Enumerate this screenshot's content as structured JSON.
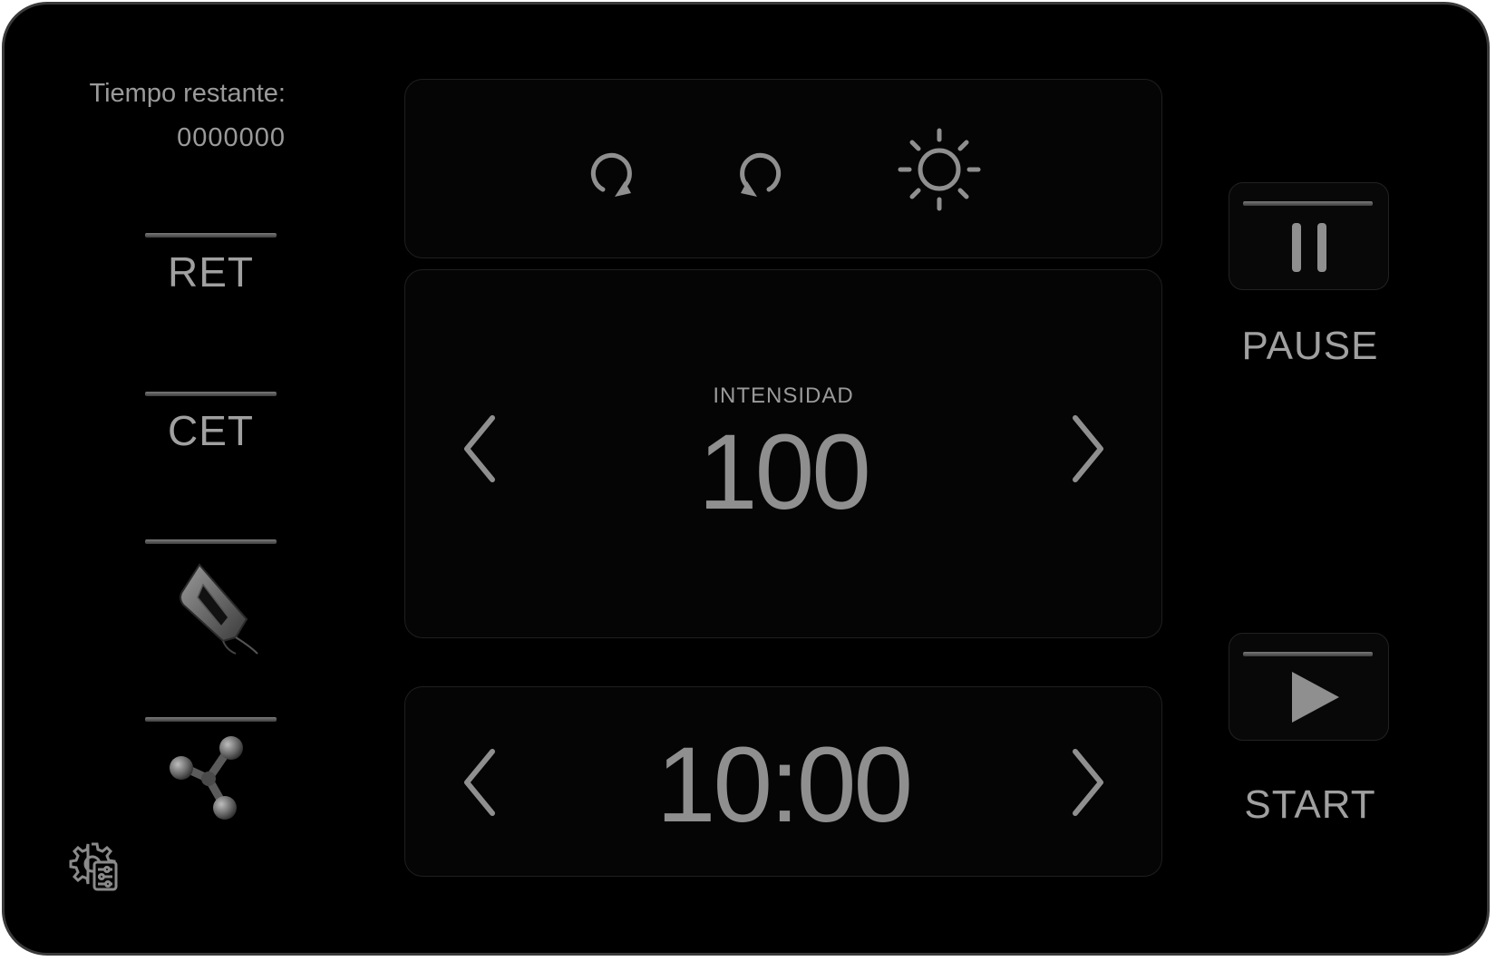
{
  "status": {
    "time_remaining_label": "Tiempo restante:",
    "time_remaining_value": "0000000"
  },
  "modes": [
    {
      "label": "RET",
      "icon": "ret-mode"
    },
    {
      "label": "CET",
      "icon": "cet-mode"
    },
    {
      "label": "",
      "icon": "handpiece-icon"
    },
    {
      "label": "",
      "icon": "tripolar-electrode-icon"
    }
  ],
  "settings": {
    "icon": "settings-gear-icon"
  },
  "top_panel": {
    "icons": [
      "rotate-clockwise-icon",
      "rotate-counterclockwise-icon",
      "brightness-icon"
    ]
  },
  "intensity": {
    "label": "INTENSIDAD",
    "value": "100"
  },
  "timer": {
    "value": "10:00"
  },
  "controls": {
    "pause_label": "PAUSE",
    "start_label": "START"
  },
  "colors": {
    "background": "#000000",
    "foreground": "#9a9a9a"
  }
}
